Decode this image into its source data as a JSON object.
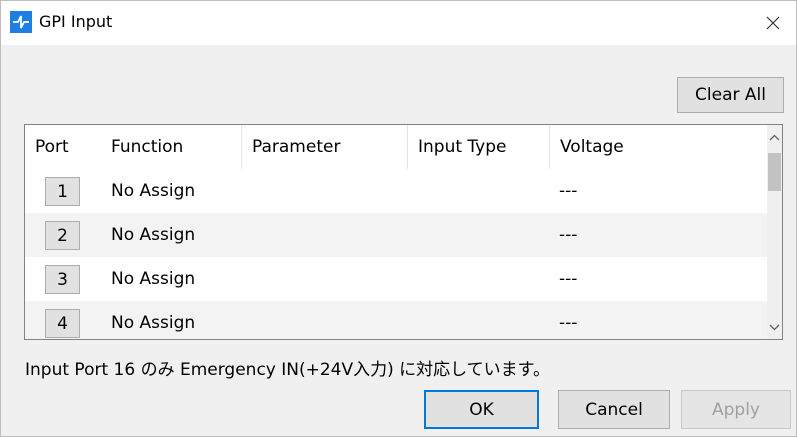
{
  "window": {
    "title": "GPI Input"
  },
  "toolbar": {
    "clear_all_label": "Clear All"
  },
  "table": {
    "columns": [
      "Port",
      "Function",
      "Parameter",
      "Input Type",
      "Voltage"
    ],
    "rows": [
      {
        "port": "1",
        "function": "No Assign",
        "parameter": "",
        "input_type": "",
        "voltage": "---"
      },
      {
        "port": "2",
        "function": "No Assign",
        "parameter": "",
        "input_type": "",
        "voltage": "---"
      },
      {
        "port": "3",
        "function": "No Assign",
        "parameter": "",
        "input_type": "",
        "voltage": "---"
      },
      {
        "port": "4",
        "function": "No Assign",
        "parameter": "",
        "input_type": "",
        "voltage": "---"
      }
    ]
  },
  "note": "Input Port 16 のみ Emergency IN(+24V入力) に対応しています。",
  "footer": {
    "ok_label": "OK",
    "cancel_label": "Cancel",
    "apply_label": "Apply"
  },
  "colors": {
    "accent": "#0078d7",
    "app_icon": "#1e7fe0",
    "row_alt": "#f3f3f3"
  },
  "icons": {
    "app": "gpi-input-app-icon",
    "close": "close-icon",
    "scroll_up": "chevron-up-icon",
    "scroll_down": "chevron-down-icon"
  }
}
